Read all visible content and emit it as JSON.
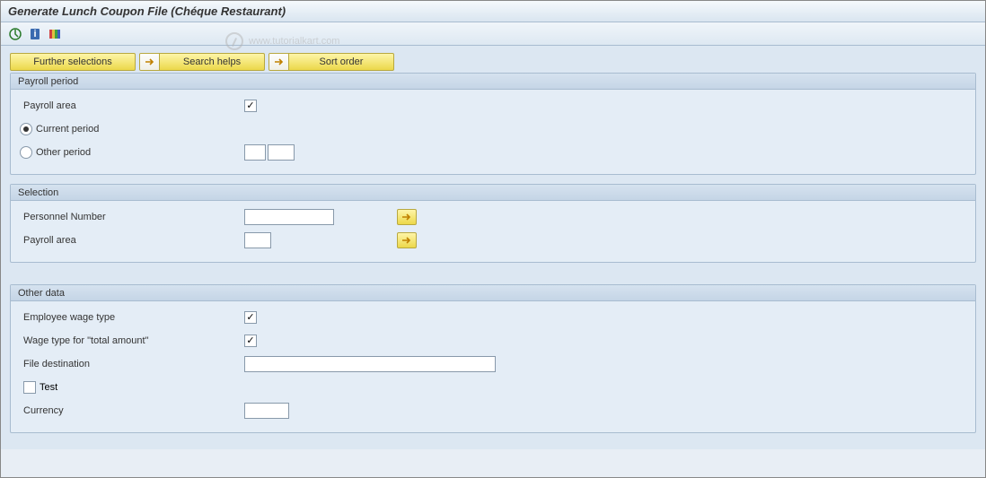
{
  "title": "Generate Lunch Coupon File (Chéque Restaurant)",
  "watermark": "www.tutorialkart.com",
  "buttons": {
    "further_selections": "Further selections",
    "search_helps": "Search helps",
    "sort_order": "Sort order"
  },
  "groups": {
    "payroll_period": {
      "header": "Payroll period",
      "payroll_area_label": "Payroll area",
      "payroll_area_value": "",
      "current_period": "Current period",
      "other_period": "Other period",
      "other_period_val1": "",
      "other_period_val2": ""
    },
    "selection": {
      "header": "Selection",
      "personnel_number_label": "Personnel Number",
      "personnel_number_value": "",
      "payroll_area_label": "Payroll area",
      "payroll_area_value": ""
    },
    "other_data": {
      "header": "Other data",
      "employee_wage_type_label": "Employee wage type",
      "employee_wage_type_value": "",
      "wage_type_total_label": "Wage type for \"total amount\"",
      "wage_type_total_value": "",
      "file_destination_label": "File destination",
      "file_destination_value": "",
      "test_label": "Test",
      "currency_label": "Currency",
      "currency_value": ""
    }
  }
}
